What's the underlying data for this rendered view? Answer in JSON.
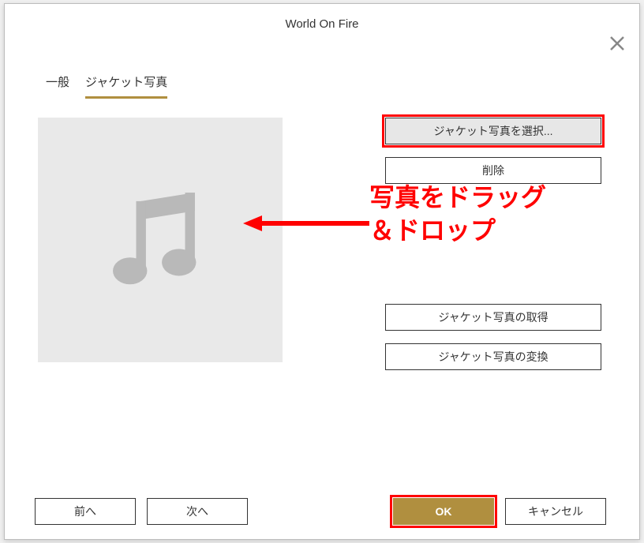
{
  "header": {
    "title": "World On Fire"
  },
  "tabs": {
    "general": "一般",
    "jacket_photo": "ジャケット写真"
  },
  "buttons": {
    "select_jacket": "ジャケット写真を選択...",
    "delete": "削除",
    "get_jacket": "ジャケット写真の取得",
    "convert_jacket": "ジャケット写真の変換"
  },
  "footer": {
    "prev": "前へ",
    "next": "次へ",
    "ok": "OK",
    "cancel": "キャンセル"
  },
  "annotation": {
    "line1": "写真をドラッグ",
    "line2": "＆ドロップ"
  }
}
